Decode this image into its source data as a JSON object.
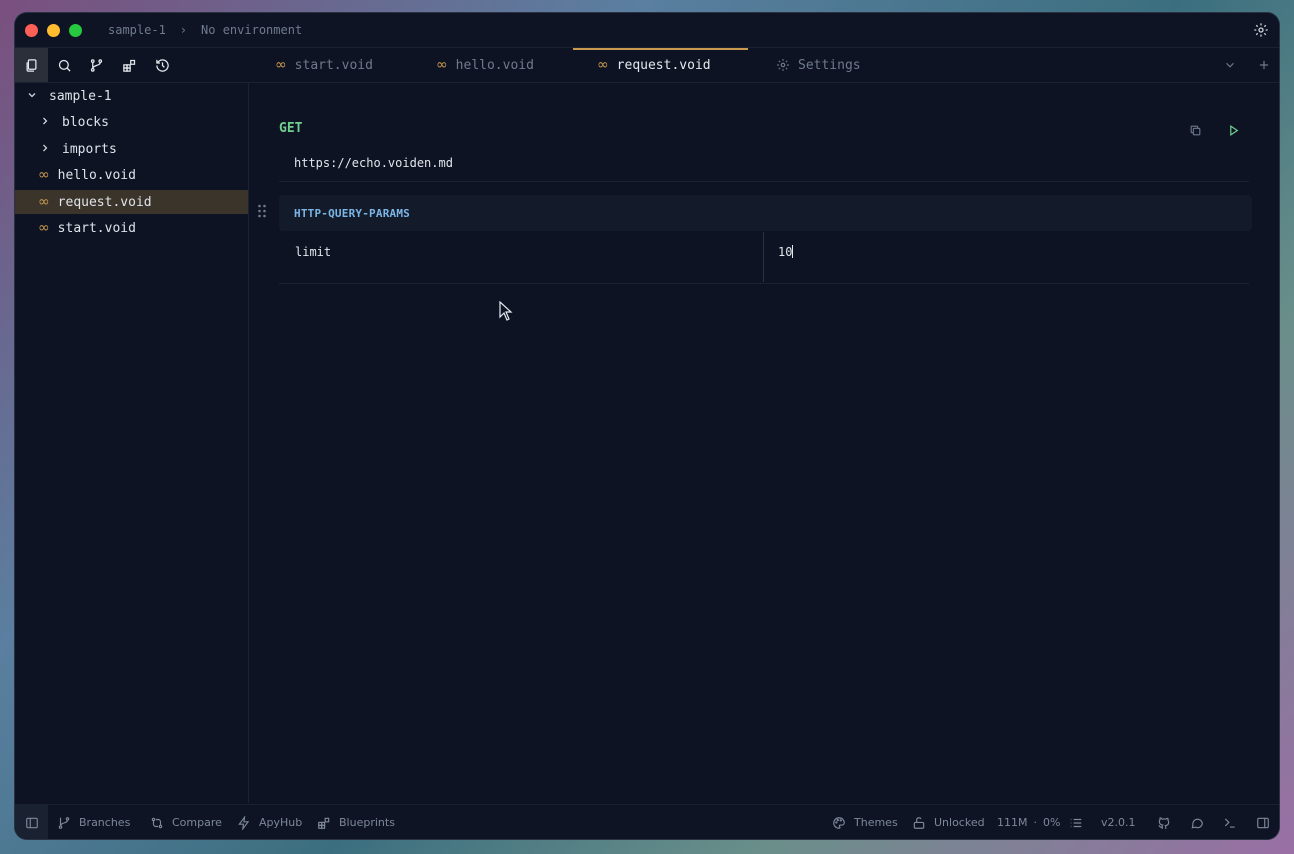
{
  "titlebar": {
    "project": "sample-1",
    "environment": "No environment"
  },
  "tabs": [
    {
      "label": "start.void",
      "active": false
    },
    {
      "label": "hello.void",
      "active": false
    },
    {
      "label": "request.void",
      "active": true
    },
    {
      "label": "Settings",
      "active": false
    }
  ],
  "sidebar": {
    "root": "sample-1",
    "items": [
      {
        "label": "blocks",
        "type": "folder"
      },
      {
        "label": "imports",
        "type": "folder"
      },
      {
        "label": "hello.void",
        "type": "file"
      },
      {
        "label": "request.void",
        "type": "file",
        "selected": true
      },
      {
        "label": "start.void",
        "type": "file"
      }
    ]
  },
  "request": {
    "method": "GET",
    "url": "https://echo.voiden.md",
    "params_title": "HTTP-QUERY-PARAMS",
    "params": [
      {
        "key": "limit",
        "value": "10"
      }
    ]
  },
  "statusbar": {
    "branches": "Branches",
    "compare": "Compare",
    "apyhub": "ApyHub",
    "blueprints": "Blueprints",
    "themes": "Themes",
    "lock": "Unlocked",
    "memory": "111M",
    "mem_sep": "·",
    "cpu": "0%",
    "version": "v2.0.1"
  },
  "colors": {
    "accent": "#c99a4e",
    "method_get": "#6fcf8d",
    "params_title": "#7bb6e6",
    "background": "#0d1322"
  }
}
